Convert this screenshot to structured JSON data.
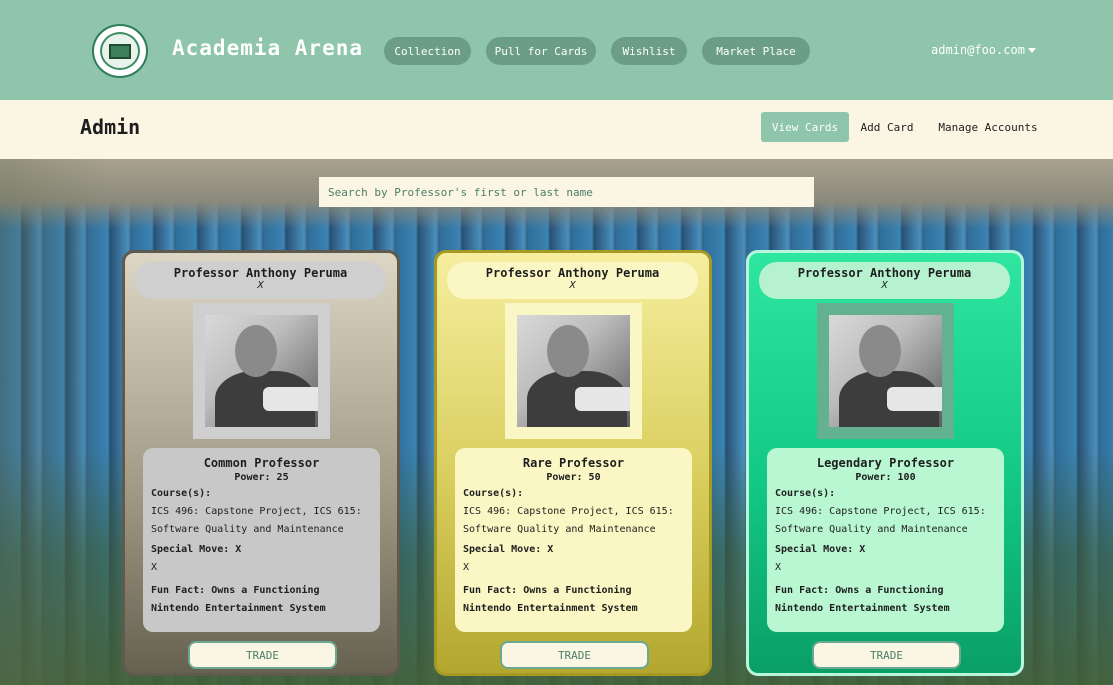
{
  "navbar": {
    "brand": "Academia Arena",
    "links": [
      "Collection",
      "Pull for Cards",
      "Wishlist",
      "Market Place"
    ],
    "user": "admin@foo.com",
    "color": "#8ec5ab"
  },
  "subnav": {
    "title": "Admin",
    "links": [
      "View Cards",
      "Add Card",
      "Manage Accounts"
    ],
    "active": "View Cards"
  },
  "search": {
    "placeholder": "Search by Professor's first or last name"
  },
  "cards": [
    {
      "name": "Professor Anthony Peruma",
      "subtitle": "X",
      "rarity": "Common Professor",
      "power": "Power: 25",
      "courses_label": "Course(s):",
      "courses": "ICS 496: Capstone Project, ICS 615: Software Quality and Maintenance",
      "special_move": "Special Move: X",
      "special_move_desc": "X",
      "fun_fact": "Fun Fact: Owns a Functioning Nintendo Entertainment System",
      "trade_label": "TRADE"
    },
    {
      "name": "Professor Anthony Peruma",
      "subtitle": "X",
      "rarity": "Rare Professor",
      "power": "Power: 50",
      "courses_label": "Course(s):",
      "courses": "ICS 496: Capstone Project, ICS 615: Software Quality and Maintenance",
      "special_move": "Special Move: X",
      "special_move_desc": "X",
      "fun_fact": "Fun Fact: Owns a Functioning Nintendo Entertainment System",
      "trade_label": "TRADE"
    },
    {
      "name": "Professor Anthony Peruma",
      "subtitle": "X",
      "rarity": "Legendary Professor",
      "power": "Power: 100",
      "courses_label": "Course(s):",
      "courses": "ICS 496: Capstone Project, ICS 615: Software Quality and Maintenance",
      "special_move": "Special Move: X",
      "special_move_desc": "X",
      "fun_fact": "Fun Fact: Owns a Functioning Nintendo Entertainment System",
      "trade_label": "TRADE"
    }
  ]
}
